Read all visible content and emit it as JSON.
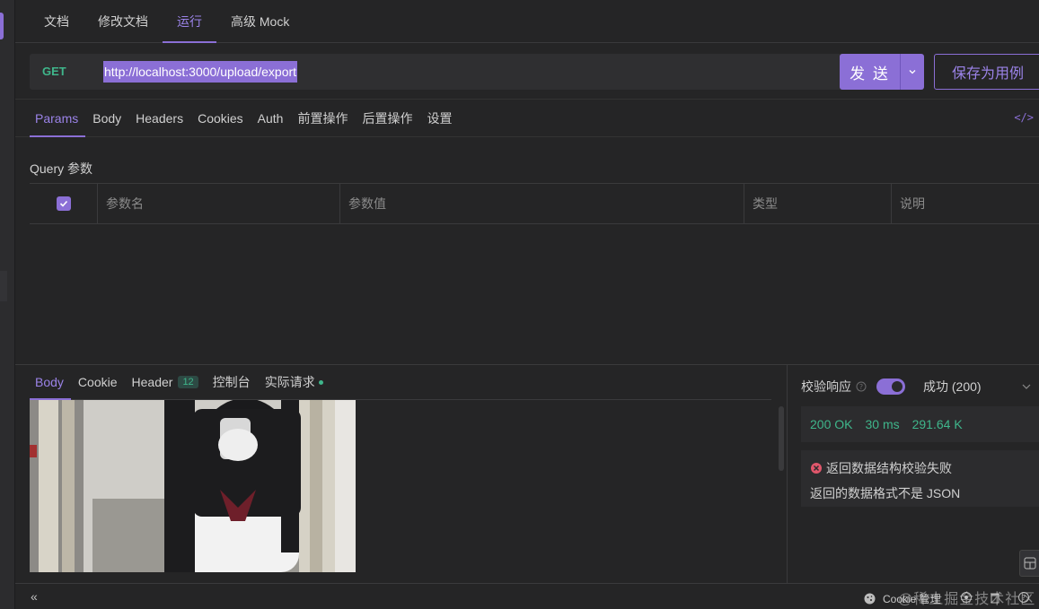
{
  "top_tabs": [
    "文档",
    "修改文档",
    "运行",
    "高级 Mock"
  ],
  "active_top_tab": "运行",
  "request": {
    "method": "GET",
    "url": "http://localhost:3000/upload/export",
    "send_label": "发 送",
    "save_label": "保存为用例"
  },
  "request_tabs": [
    "Params",
    "Body",
    "Headers",
    "Cookies",
    "Auth",
    "前置操作",
    "后置操作",
    "设置"
  ],
  "active_request_tab": "Params",
  "query": {
    "title": "Query 参数",
    "columns": [
      "参数名",
      "参数值",
      "类型",
      "说明"
    ]
  },
  "response_tabs": {
    "body": "Body",
    "cookie": "Cookie",
    "header": "Header",
    "header_count": "12",
    "console": "控制台",
    "actual_request": "实际请求"
  },
  "validation": {
    "label": "校验响应",
    "enabled": true,
    "result": "成功 (200)"
  },
  "response_status": {
    "code": "200 OK",
    "time": "30 ms",
    "size": "291.64 K"
  },
  "error": {
    "title": "返回数据结构校验失败",
    "message": "返回的数据格式不是 JSON"
  },
  "status_bar": {
    "cookie_manager": "Cookie 管理",
    "watermark": "@稀土掘金技术社区"
  },
  "colors": {
    "accent": "#8b6fd6",
    "success": "#3fb68b",
    "error": "#e0566b"
  }
}
